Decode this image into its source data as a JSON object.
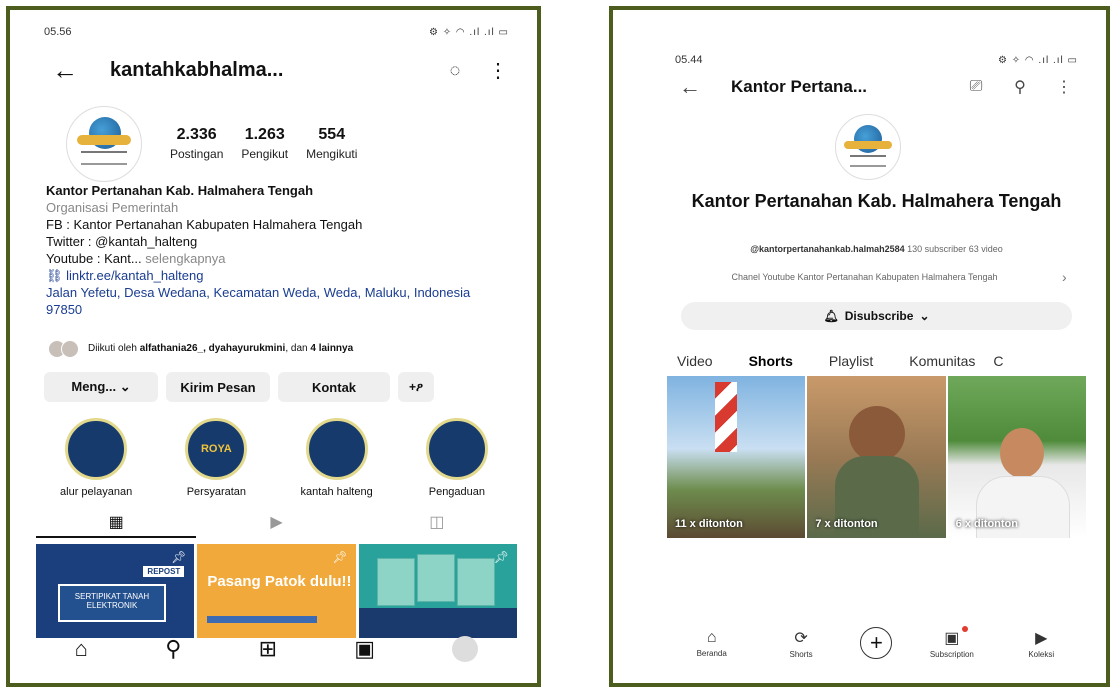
{
  "left": {
    "status": {
      "time": "05.56",
      "icons": "⚙ ✧ ◠ .ıl .ıl ▭"
    },
    "header": {
      "username": "kantahkabhalma...",
      "back": "←",
      "bell": "◌",
      "more": "⋮"
    },
    "stats": [
      {
        "value": "2.336",
        "label": "Postingan"
      },
      {
        "value": "1.263",
        "label": "Pengikut"
      },
      {
        "value": "554",
        "label": "Mengikuti"
      }
    ],
    "bio": {
      "name": "Kantor Pertanahan Kab. Halmahera Tengah",
      "category": "Organisasi Pemerintah",
      "fb": "FB : Kantor Pertanahan Kabupaten Halmahera Tengah",
      "twitter": "Twitter : @kantah_halteng",
      "youtube": "Youtube : Kant...",
      "more": "selengkapnya",
      "link": "linktr.ee/kantah_halteng",
      "address": "Jalan Yefetu, Desa Wedana, Kecamatan Weda, Weda, Maluku, Indonesia 97850"
    },
    "followed_by": {
      "prefix": "Diikuti oleh",
      "users": "alfathania26_, dyahayurukmini",
      "and": ", dan",
      "others": "4 lainnya"
    },
    "buttons": {
      "follow": "Meng... ⌄",
      "message": "Kirim Pesan",
      "contact": "Kontak",
      "add": "+ዖ"
    },
    "highlights": [
      {
        "label": "alur pelayanan",
        "badge": ""
      },
      {
        "label": "Persyaratan",
        "badge": "ROYA"
      },
      {
        "label": "kantah halteng",
        "badge": ""
      },
      {
        "label": "Pengaduan",
        "badge": ""
      }
    ],
    "tabs": {
      "grid": "▦",
      "reels": "▶",
      "tagged": "◫"
    },
    "posts": {
      "p1_tag": "REPOST",
      "p1_text": "SERTIPIKAT TANAH ELEKTRONIK",
      "p2_text": "Pasang Patok dulu!!"
    },
    "nav": {
      "home": "⌂",
      "search": "⚲",
      "add": "⊞",
      "reels": "▣"
    }
  },
  "right": {
    "status": {
      "time": "05.44",
      "icons": "⚙ ✧ ◠ .ıl .ıl ▭"
    },
    "header": {
      "title": "Kantor Pertana...",
      "back": "←",
      "cast": "⎚",
      "search": "⚲",
      "more": "⋮"
    },
    "channel": {
      "name": "Kantor Pertanahan Kab. Halmahera Tengah",
      "handle": "@kantorpertanahankab.halmah2584",
      "subscribers": "130 subscriber",
      "videos": "63 video",
      "description": "Chanel Youtube Kantor Pertanahan Kabupaten Halmahera Tengah",
      "chevron": "›"
    },
    "subscribe": {
      "bell": "🔔︎",
      "label": "Disubscribe",
      "chevron": "⌄"
    },
    "tabs": [
      "Video",
      "Shorts",
      "Playlist",
      "Komunitas",
      "C"
    ],
    "shorts": [
      {
        "views": "11 x ditonton"
      },
      {
        "views": "7 x ditonton"
      },
      {
        "views": "6 x ditonton"
      }
    ],
    "nav": [
      {
        "icon": "⌂",
        "label": "Beranda"
      },
      {
        "icon": "⟳",
        "label": "Shorts"
      },
      {
        "icon": "+",
        "label": ""
      },
      {
        "icon": "▣",
        "label": "Subscription"
      },
      {
        "icon": "▶",
        "label": "Koleksi"
      }
    ]
  }
}
